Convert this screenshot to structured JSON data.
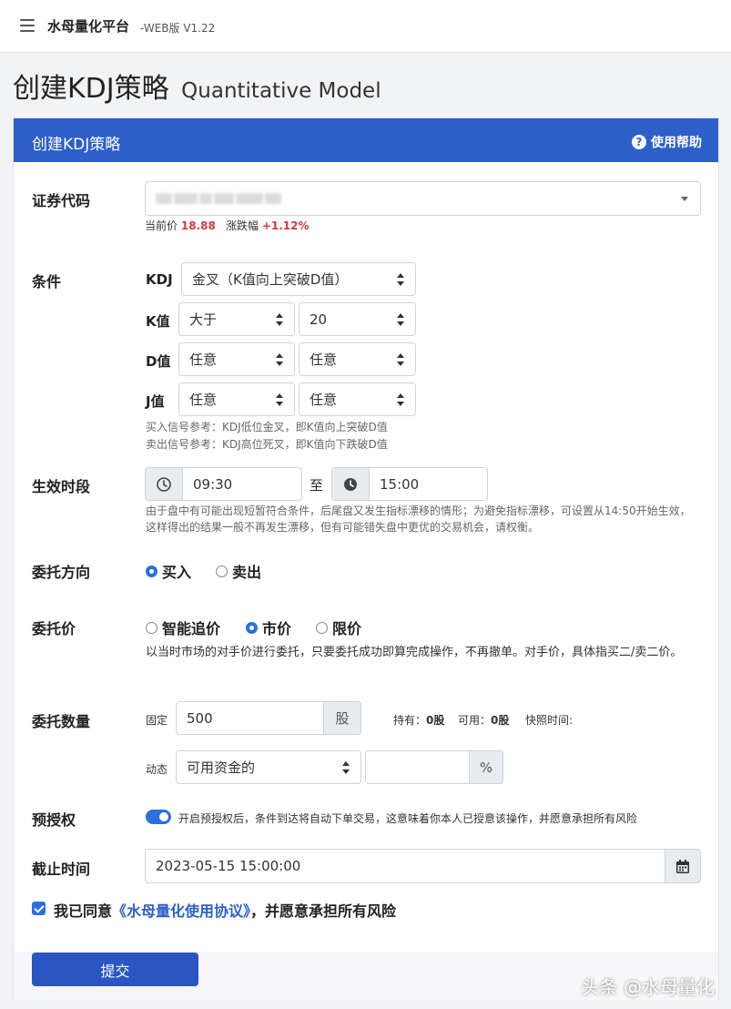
{
  "topbar": {
    "brand": "水母量化平台",
    "version": "-WEB版 V1.22"
  },
  "page": {
    "title": "创建KDJ策略",
    "subtitle": "Quantitative Model"
  },
  "card": {
    "title": "创建KDJ策略",
    "help": "使用帮助"
  },
  "security": {
    "label": "证券代码",
    "current_price_label": "当前价",
    "current_price": "18.88",
    "change_label": "涨跌幅",
    "change": "+1.12%"
  },
  "condition": {
    "label": "条件",
    "kdj_label": "KDJ",
    "kdj_value": "金叉（K值向上突破D值）",
    "k_label": "K值",
    "k_op": "大于",
    "k_val": "20",
    "d_label": "D值",
    "d_op": "任意",
    "d_val": "任意",
    "j_label": "J值",
    "j_op": "任意",
    "j_val": "任意",
    "hint_buy": "买入信号参考：KDJ低位金叉，即K值向上突破D值",
    "hint_sell": "卖出信号参考：KDJ高位死叉，即K值向下跌破D值"
  },
  "period": {
    "label": "生效时段",
    "start": "09:30",
    "to": "至",
    "end": "15:00",
    "hint": "由于盘中有可能出现短暂符合条件，后尾盘又发生指标漂移的情形；为避免指标漂移，可设置从14:50开始生效，这样得出的结果一般不再发生漂移，但有可能错失盘中更优的交易机会，请权衡。"
  },
  "direction": {
    "label": "委托方向",
    "buy": "买入",
    "sell": "卖出"
  },
  "price": {
    "label": "委托价",
    "smart": "智能追价",
    "market": "市价",
    "limit": "限价",
    "hint": "以当时市场的对手价进行委托，只要委托成功即算完成操作，不再撤单。对手价，具体指买二/卖二价。"
  },
  "quantity": {
    "label": "委托数量",
    "fixed_label": "固定",
    "fixed_value": "500",
    "unit": "股",
    "holding_label": "持有：",
    "holding": "0股",
    "available_label": "可用：",
    "available": "0股",
    "snapshot_label": "快照时间:",
    "dynamic_label": "动态",
    "dynamic_value": "可用资金的",
    "percent_unit": "%"
  },
  "preauth": {
    "label": "预授权",
    "text": "开启预授权后，条件到达将自动下单交易，这意味着你本人已授意该操作，并愿意承担所有风险"
  },
  "deadline": {
    "label": "截止时间",
    "value": "2023-05-15 15:00:00"
  },
  "agree": {
    "prefix": "我已同意",
    "link": "《水母量化使用协议》",
    "suffix": "，并愿意承担所有风险"
  },
  "submit": "提交",
  "watermark": "头条 @水母量化",
  "colors": {
    "header_blue": "#2d5fc9",
    "accent_blue": "#2d6fde",
    "price_red": "#d9363e"
  },
  "icons": {
    "menu": "hamburger-icon",
    "help": "question-circle-icon",
    "clock": "clock-icon",
    "calendar": "calendar-icon"
  }
}
